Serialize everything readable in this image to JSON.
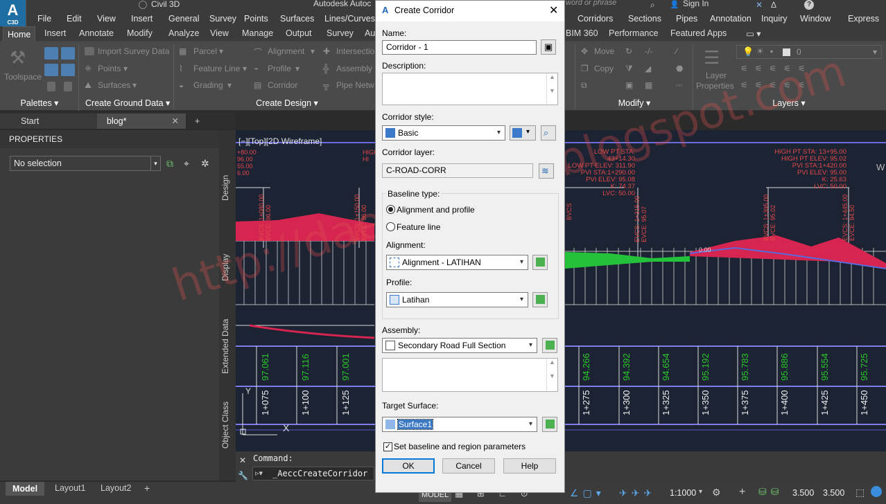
{
  "app": {
    "logo_main": "A",
    "logo_sub": "C3D",
    "workspace": "Civil 3D",
    "title": "Autodesk Autoc",
    "search_placeholder": "word or phrase",
    "sign_in": "Sign In"
  },
  "menu": [
    "File",
    "Edit",
    "View",
    "Insert",
    "General",
    "Survey",
    "Points",
    "Surfaces",
    "Lines/Curves",
    "Corridors",
    "Sections",
    "Pipes",
    "Annotation",
    "Inquiry",
    "Window",
    "Express"
  ],
  "tabs": [
    "Home",
    "Insert",
    "Annotate",
    "Modify",
    "Analyze",
    "View",
    "Manage",
    "Output",
    "Survey",
    "Au",
    "BIM 360",
    "Performance",
    "Featured Apps"
  ],
  "ribbon": {
    "toolspace": "Toolspace",
    "import_survey": "Import Survey Data",
    "points": "Points",
    "surfaces": "Surfaces",
    "parcel": "Parcel",
    "feature_line": "Feature Line",
    "grading": "Grading",
    "alignment": "Alignment",
    "profile": "Profile",
    "corridor": "Corridor",
    "intersection": "Intersectio",
    "assembly": "Assembly",
    "pipe_network": "Pipe Netw",
    "move": "Move",
    "copy": "Copy",
    "layer_properties_1": "Layer",
    "layer_properties_2": "Properties",
    "layer_value": "0",
    "panels": {
      "palettes": "Palettes",
      "ground": "Create Ground Data",
      "design": "Create Design",
      "modify": "Modify",
      "layers": "Layers"
    }
  },
  "doc_tabs": {
    "start": "Start",
    "current": "blog*"
  },
  "properties": {
    "title": "PROPERTIES",
    "selection": "No selection",
    "side_tabs": [
      "Design",
      "Display",
      "Extended Data",
      "Object Class"
    ]
  },
  "viewport": {
    "label": "[−][Top][2D Wireframe]",
    "left_annot": [
      "+80.00",
      "96.00",
      "55.00",
      "6.00"
    ],
    "high_label": [
      "HIGH",
      "HI"
    ],
    "low_pt": [
      "LOW PT STA: 43+14.30",
      "LOW PT ELEV: 311.90",
      "PVI STA:1+290.00",
      "PVI ELEV: 95.08",
      "K: 74.37",
      "LVC: 50.00"
    ],
    "high_pt": [
      "HIGH PT STA: 13+95.00",
      "HIGH PT ELEV: 95.02",
      "PVI STA:1+420.00",
      "PVI ELEV: 95.00",
      "K: 25.63",
      "LVC: 50.00"
    ],
    "vert_labels": [
      "BVCS: 1+080.00",
      "BVCE: 96.00",
      "BVCS: 1+150.00",
      "BVCE: 96.00",
      "EVCS: 1+315.00",
      "EVCE: 95.07",
      "BVCS: 1+395.00",
      "BVCE: 95.02",
      "EVCS: 1+445.00",
      "EVCE: 94.50",
      "BVCS"
    ],
    "elev_left": [
      "97.061",
      "97.116",
      "97.001"
    ],
    "elev_right": [
      "94.266",
      "94.392",
      "94.654",
      "95.192",
      "95.783",
      "95.886",
      "95.554",
      "95.725"
    ],
    "sta_left": [
      "1+075",
      "1+100",
      "1+125"
    ],
    "sta_right": [
      "1+275",
      "1+300",
      "1+325",
      "1+350",
      "1+375",
      "1+400",
      "1+425",
      "1+450"
    ],
    "small_label": "0.00",
    "edge_letter": "W"
  },
  "command": {
    "label": "Command:",
    "input": "_AeccCreateCorridor"
  },
  "status": {
    "tabs": [
      "Model",
      "Layout1",
      "Layout2"
    ],
    "model_btn": "MODEL",
    "scale": "1:1000",
    "val1": "3.500",
    "val2": "3.500"
  },
  "dialog": {
    "title": "Create Corridor",
    "name_label": "Name:",
    "name_value": "Corridor - 1",
    "desc_label": "Description:",
    "style_label": "Corridor style:",
    "style_value": "Basic",
    "layer_label": "Corridor layer:",
    "layer_value": "C-ROAD-CORR",
    "baseline_label": "Baseline type:",
    "baseline_opt1": "Alignment and profile",
    "baseline_opt2": "Feature line",
    "alignment_label": "Alignment:",
    "alignment_value": "Alignment - LATIHAN",
    "profile_label": "Profile:",
    "profile_value": "Latihan",
    "assembly_label": "Assembly:",
    "assembly_value": "Secondary Road Full Section",
    "target_label": "Target Surface:",
    "target_value": "Surface1",
    "checkbox_label": "Set baseline and region parameters",
    "ok": "OK",
    "cancel": "Cancel",
    "help": "Help"
  },
  "watermark": "http://daengjattin.blogspot.com"
}
